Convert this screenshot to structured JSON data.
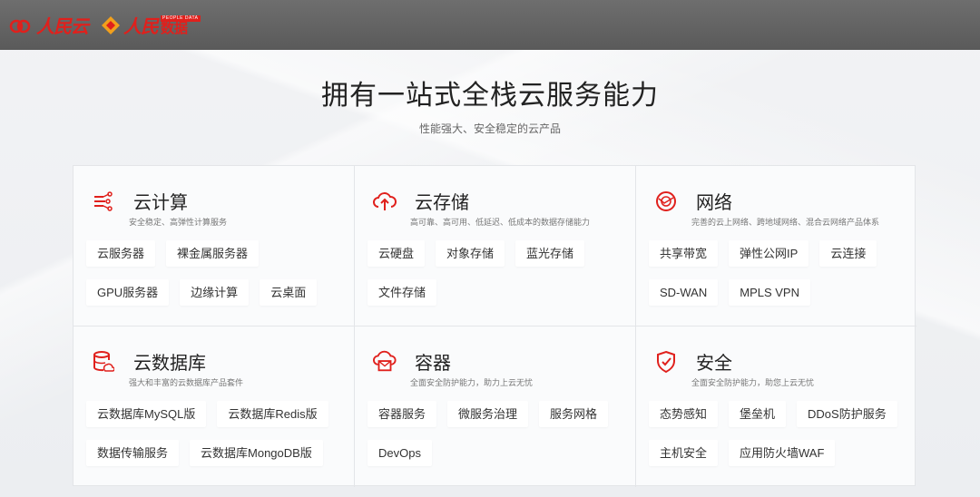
{
  "header": {
    "logo1_text": "人民云",
    "logo2_text": "人民",
    "logo2_sub": "数据",
    "logo2_tiny": "PEOPLE DATA"
  },
  "hero": {
    "title": "拥有一站式全栈云服务能力",
    "subtitle": "性能强大、安全稳定的云产品"
  },
  "colors": {
    "accent": "#e0201c"
  },
  "products": [
    {
      "icon": "compute-icon",
      "title": "云计算",
      "desc": "安全稳定、高弹性计算服务",
      "tags": [
        "云服务器",
        "裸金属服务器",
        "GPU服务器",
        "边缘计算",
        "云桌面"
      ]
    },
    {
      "icon": "cloud-upload-icon",
      "title": "云存储",
      "desc": "高可靠、高可用、低延迟、低成本的数据存储能力",
      "tags": [
        "云硬盘",
        "对象存储",
        "蓝光存储",
        "文件存储"
      ]
    },
    {
      "icon": "globe-network-icon",
      "title": "网络",
      "desc": "完善的云上网络、跨地域网络、混合云网络产品体系",
      "tags": [
        "共享带宽",
        "弹性公网IP",
        "云连接",
        "SD-WAN",
        "MPLS VPN"
      ]
    },
    {
      "icon": "database-icon",
      "title": "云数据库",
      "desc": "强大和丰富的云数据库产品套件",
      "tags": [
        "云数据库MySQL版",
        "云数据库Redis版",
        "数据传输服务",
        "云数据库MongoDB版"
      ]
    },
    {
      "icon": "container-cloud-icon",
      "title": "容器",
      "desc": "全面安全防护能力，助力上云无忧",
      "tags": [
        "容器服务",
        "微服务治理",
        "服务网格",
        "DevOps"
      ]
    },
    {
      "icon": "shield-check-icon",
      "title": "安全",
      "desc": "全面安全防护能力，助您上云无忧",
      "tags": [
        "态势感知",
        "堡垒机",
        "DDoS防护服务",
        "主机安全",
        "应用防火墙WAF"
      ]
    }
  ]
}
